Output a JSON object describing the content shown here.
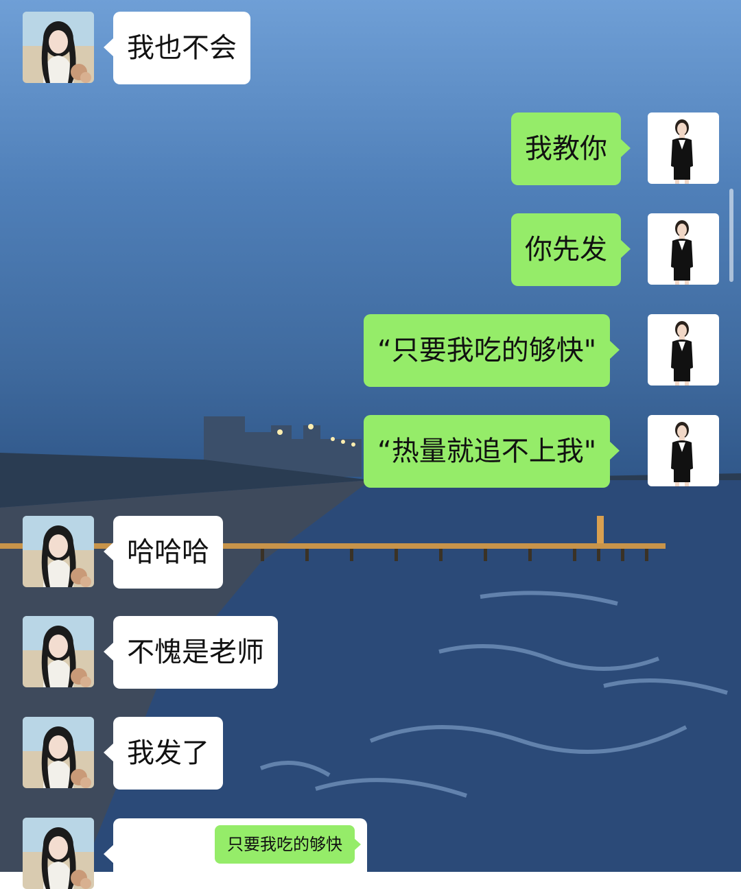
{
  "chat": {
    "messages": [
      {
        "side": "left",
        "text": "我也不会",
        "avatar": "girl-avatar"
      },
      {
        "side": "right",
        "text": "我教你",
        "avatar": "teacher-avatar"
      },
      {
        "side": "right",
        "text": "你先发",
        "avatar": "teacher-avatar"
      },
      {
        "side": "right",
        "text": "“只要我吃的够快\"",
        "avatar": "teacher-avatar"
      },
      {
        "side": "right",
        "text": "“热量就追不上我\"",
        "avatar": "teacher-avatar"
      },
      {
        "side": "left",
        "text": "哈哈哈",
        "avatar": "girl-avatar"
      },
      {
        "side": "left",
        "text": "不愧是老师",
        "avatar": "girl-avatar"
      },
      {
        "side": "left",
        "text": "我发了",
        "avatar": "girl-avatar"
      },
      {
        "side": "left",
        "text": "只要我吃的够快",
        "avatar": "girl-avatar",
        "type": "screenshot-reply"
      }
    ]
  },
  "colors": {
    "incoming_bubble": "#ffffff",
    "outgoing_bubble": "#95ec69",
    "background": "#3f6a9e"
  },
  "background": {
    "scene": "seaside-pier-dusk"
  }
}
